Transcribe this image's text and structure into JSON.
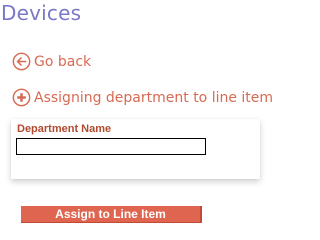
{
  "header": {
    "title": "Devices"
  },
  "nav": {
    "go_back_label": "Go back",
    "go_back_icon": "arrow-left-circle-icon",
    "assign_label": "Assigning department to line item",
    "assign_icon": "plus-circle-icon"
  },
  "form": {
    "department_label": "Department Name",
    "department_value": "",
    "department_placeholder": ""
  },
  "actions": {
    "assign_button_label": "Assign to Line Item"
  },
  "colors": {
    "title": "#7b78c8",
    "link": "#d86a52",
    "label": "#b24a2f",
    "button": "#e06550"
  }
}
